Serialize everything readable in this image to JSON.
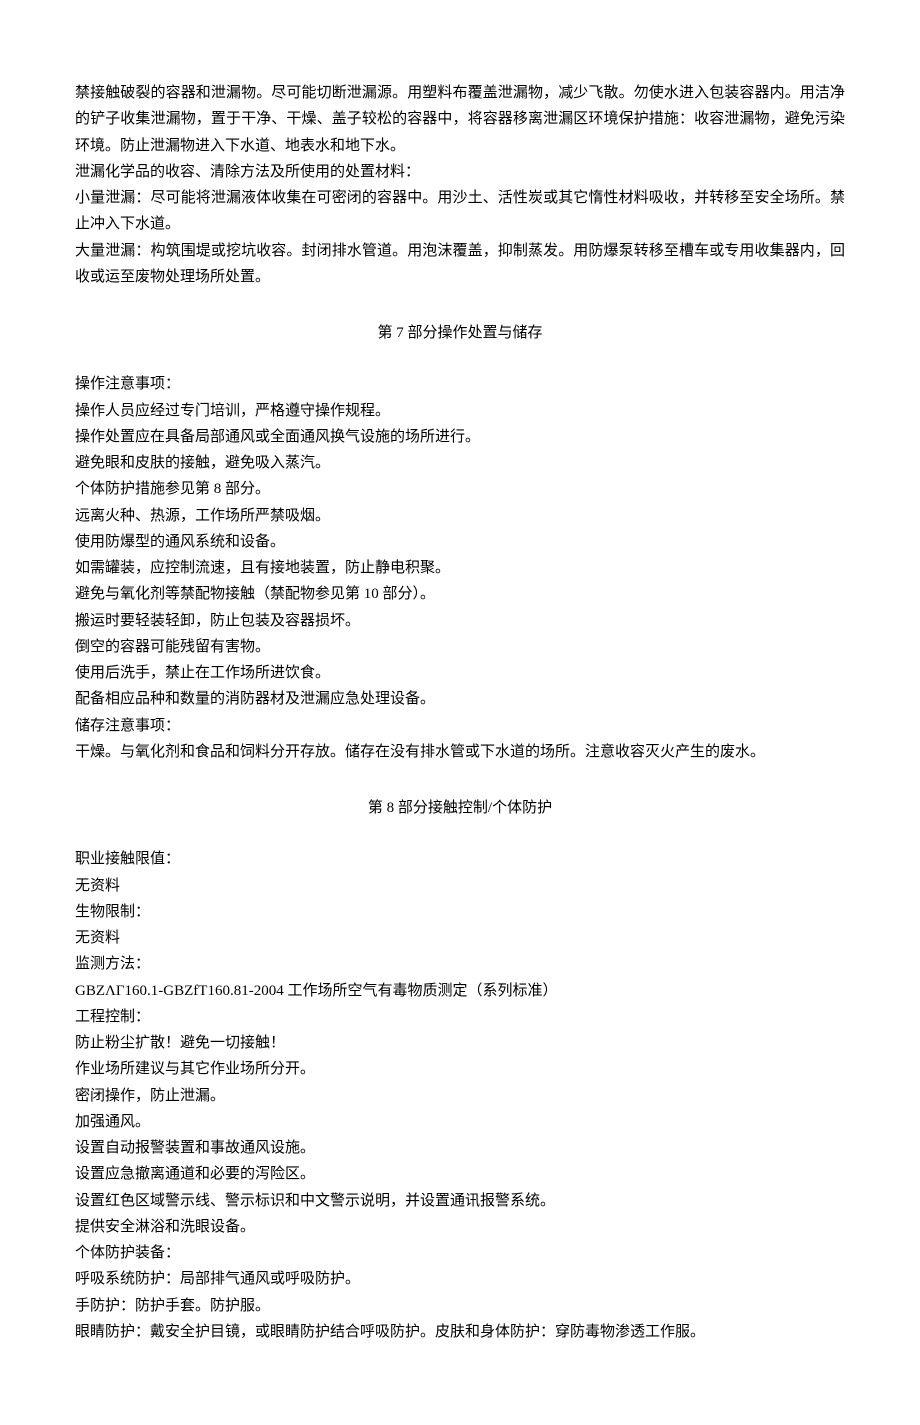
{
  "intro": {
    "p1": "禁接触破裂的容器和泄漏物。尽可能切断泄漏源。用塑料布覆盖泄漏物，减少飞散。勿使水进入包装容器内。用洁净的铲子收集泄漏物，置于干净、干燥、盖子较松的容器中，将容器移离泄漏区环境保护措施：收容泄漏物，避免污染环境。防止泄漏物进入下水道、地表水和地下水。",
    "p2": "泄漏化学品的收容、清除方法及所使用的处置材料：",
    "p3": "小量泄漏：尽可能将泄漏液体收集在可密闭的容器中。用沙土、活性炭或其它惰性材料吸收，并转移至安全场所。禁止冲入下水道。",
    "p4": "大量泄漏：构筑围堤或挖坑收容。封闭排水管道。用泡沫覆盖，抑制蒸发。用防爆泵转移至槽车或专用收集器内，回收或运至废物处理场所处置。"
  },
  "section7": {
    "title": "第 7 部分操作处置与储存",
    "lines": [
      "操作注意事项：",
      "操作人员应经过专门培训，严格遵守操作规程。",
      "操作处置应在具备局部通风或全面通风换气设施的场所进行。",
      "避免眼和皮肤的接触，避免吸入蒸汽。",
      "个体防护措施参见第 8 部分。",
      "远离火种、热源，工作场所严禁吸烟。",
      "使用防爆型的通风系统和设备。",
      "如需罐装，应控制流速，且有接地装置，防止静电积聚。",
      "避免与氧化剂等禁配物接触（禁配物参见第 10 部分）。",
      "搬运时要轻装轻卸，防止包装及容器损坏。",
      "倒空的容器可能残留有害物。",
      "使用后洗手，禁止在工作场所进饮食。",
      "配备相应品种和数量的消防器材及泄漏应急处理设备。",
      "储存注意事项：",
      "干燥。与氧化剂和食品和饲料分开存放。储存在没有排水管或下水道的场所。注意收容灭火产生的废水。"
    ]
  },
  "section8": {
    "title": "第 8 部分接触控制/个体防护",
    "lines": [
      "职业接触限值：",
      "无资料",
      "生物限制：",
      "无资料",
      "监测方法：",
      "GBZΛΓ160.1-GBZfT160.81-2004 工作场所空气有毒物质测定（系列标准）",
      "工程控制：",
      "防止粉尘扩散！避免一切接触！",
      "作业场所建议与其它作业场所分开。",
      "密闭操作，防止泄漏。",
      "加强通风。",
      "设置自动报警装置和事故通风设施。",
      "设置应急撤离通道和必要的泻险区。",
      "设置红色区域警示线、警示标识和中文警示说明，并设置通讯报警系统。",
      "提供安全淋浴和洗眼设备。",
      "个体防护装备：",
      "呼吸系统防护：局部排气通风或呼吸防护。",
      "手防护：防护手套。防护服。",
      "眼睛防护：戴安全护目镜，或眼睛防护结合呼吸防护。皮肤和身体防护：穿防毒物渗透工作服。"
    ]
  }
}
